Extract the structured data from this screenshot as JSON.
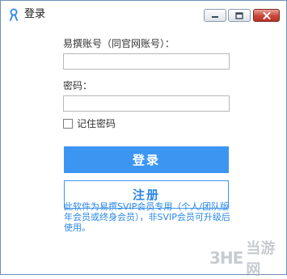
{
  "window": {
    "title": "登录",
    "minimize_label": "minimize",
    "maximize_label": "maximize",
    "close_label": "close"
  },
  "form": {
    "account_label": "易撰账号（同官网账号）：",
    "account_value": "",
    "password_label": "密码：",
    "password_value": "",
    "remember_label": "记住密码",
    "remember_checked": false
  },
  "buttons": {
    "login_label": "登录",
    "register_label": "注册"
  },
  "notice": "此软件为易撰SVIP会员专用（个人/团队版年会员或终身会员），非SVIP会员可升级后使用。",
  "watermark": {
    "logo": "3HE",
    "text": "当游网"
  },
  "colors": {
    "accent": "#3d95f2",
    "notice_text": "#2b87e6",
    "close_button": "#c8473a"
  }
}
